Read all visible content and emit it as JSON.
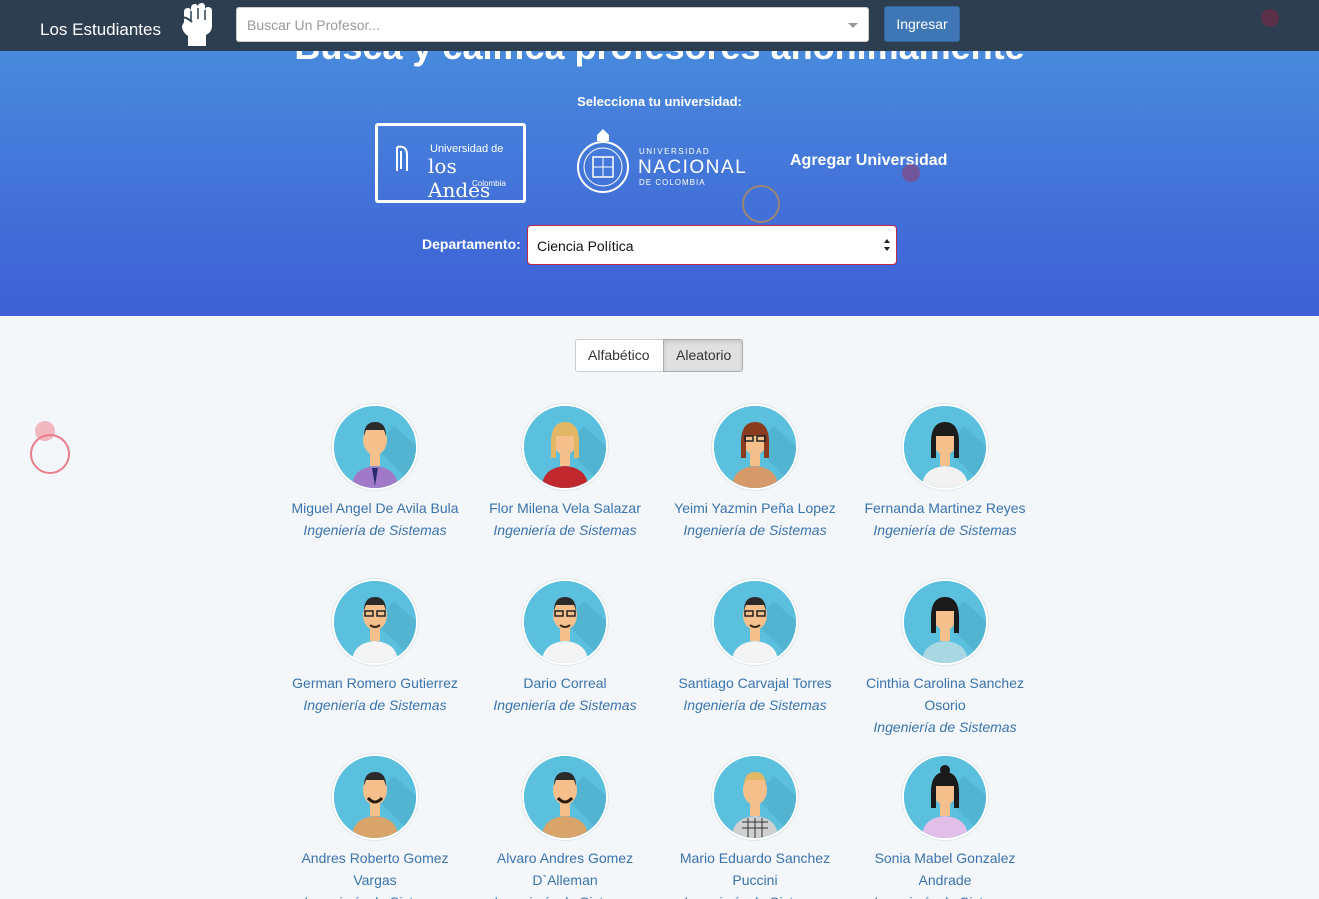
{
  "navbar": {
    "brand": "Los Estudiantes",
    "search_placeholder": "Buscar Un Profesor...",
    "login_label": "Ingresar"
  },
  "hero": {
    "title": "Busca y califica profesores anónimamente",
    "select_university_label": "Selecciona tu universidad:",
    "universities": [
      {
        "name": "Universidad de",
        "name2": "los Andes",
        "country": "Colombia"
      },
      {
        "top": "UNIVERSIDAD",
        "name": "NACIONAL",
        "bottom": "DE COLOMBIA"
      }
    ],
    "add_university_label": "Agregar Universidad",
    "department_label": "Departamento:",
    "department_value": "Ciencia Política"
  },
  "sort": {
    "alphabetic_label": "Alfabético",
    "random_label": "Aleatorio"
  },
  "professors": [
    {
      "name": "Miguel Angel De Avila Bula",
      "dept": "Ingeniería de Sistemas",
      "avatar": "man-purple-shirt"
    },
    {
      "name": "Flor Milena Vela Salazar",
      "dept": "Ingeniería de Sistemas",
      "avatar": "woman-blonde-red"
    },
    {
      "name": "Yeimi Yazmin Peña Lopez",
      "dept": "Ingeniería de Sistemas",
      "avatar": "woman-glasses-brown"
    },
    {
      "name": "Fernanda Martinez Reyes",
      "dept": "Ingeniería de Sistemas",
      "avatar": "woman-black-hair-white"
    },
    {
      "name": "German Romero Gutierrez",
      "dept": "Ingeniería de Sistemas",
      "avatar": "man-glasses-white"
    },
    {
      "name": "Dario Correal",
      "dept": "Ingeniería de Sistemas",
      "avatar": "man-glasses-white"
    },
    {
      "name": "Santiago Carvajal Torres",
      "dept": "Ingeniería de Sistemas",
      "avatar": "man-glasses-white"
    },
    {
      "name": "Cinthia Carolina Sanchez Osorio",
      "dept": "Ingeniería de Sistemas",
      "avatar": "woman-bob-teal"
    },
    {
      "name": "Andres Roberto Gomez Vargas",
      "dept": "Ingeniería de Sistemas",
      "avatar": "man-beard-tan"
    },
    {
      "name": "Alvaro Andres Gomez D`Alleman",
      "dept": "Ingeniería de Sistemas",
      "avatar": "man-beard-tan"
    },
    {
      "name": "Mario Eduardo Sanchez Puccini",
      "dept": "Ingeniería de Sistemas",
      "avatar": "man-blonde-checkered"
    },
    {
      "name": "Sonia Mabel Gonzalez Andrade",
      "dept": "Ingeniería de Sistemas",
      "avatar": "woman-bun-lilac"
    }
  ],
  "colors": {
    "navbar": "#2c3e50",
    "hero_top": "#4a92dd",
    "hero_bottom": "#3e5fd6",
    "link": "#3b73ad",
    "login_button": "#3f76b5"
  }
}
